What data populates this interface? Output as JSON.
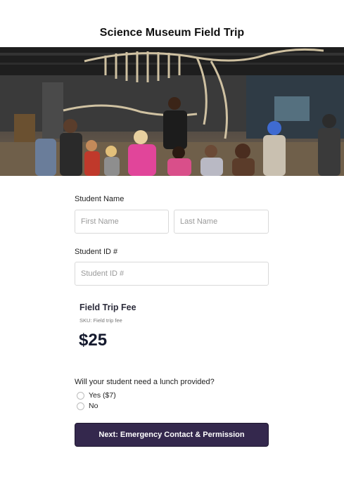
{
  "page": {
    "title": "Science Museum Field Trip"
  },
  "hero": {
    "image_subject": "museum-dinosaur-skeleton-field-trip-photo"
  },
  "form": {
    "student_name": {
      "label": "Student Name",
      "first_name_placeholder": "First Name",
      "last_name_placeholder": "Last Name",
      "first_name_value": "",
      "last_name_value": ""
    },
    "student_id": {
      "label": "Student ID #",
      "placeholder": "Student ID #",
      "value": ""
    },
    "fee": {
      "title": "Field Trip Fee",
      "sku": "SKU: Field trip fee",
      "price": "$25"
    },
    "lunch": {
      "question": "Will your student need a lunch provided?",
      "options": [
        {
          "label": "Yes ($7)",
          "selected": false
        },
        {
          "label": "No",
          "selected": false
        }
      ]
    },
    "next_button": {
      "label": "Next: Emergency Contact & Permission"
    }
  },
  "colors": {
    "button_bg": "#34284d",
    "price_text": "#151a2e",
    "input_border": "#d9d9d9"
  }
}
